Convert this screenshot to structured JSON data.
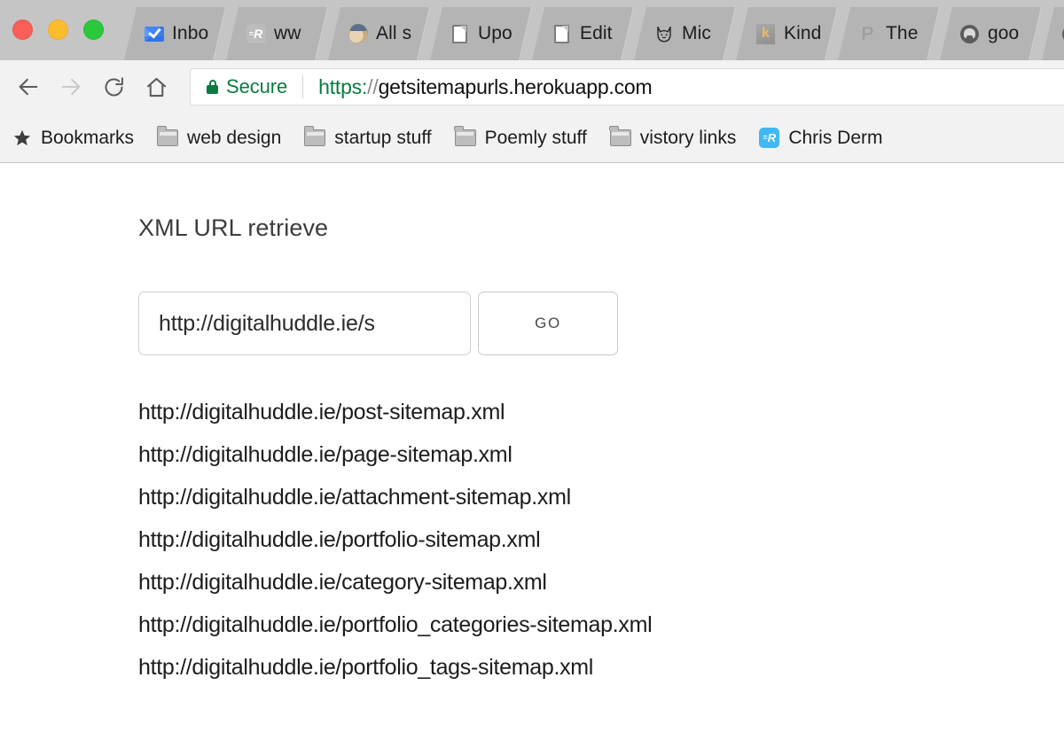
{
  "browser": {
    "window_controls": [
      {
        "name": "close",
        "color": "#f95e57"
      },
      {
        "name": "minimize",
        "color": "#fbbd2e"
      },
      {
        "name": "maximize",
        "color": "#2cc83c"
      }
    ],
    "tabs": [
      {
        "title": "Inbo",
        "favicon": "inbox-icon"
      },
      {
        "title": "ww",
        "favicon": "readme-r-icon"
      },
      {
        "title": "All s",
        "favicon": "mailchimp-icon"
      },
      {
        "title": "Upo",
        "favicon": "document-icon"
      },
      {
        "title": "Edit",
        "favicon": "document-icon"
      },
      {
        "title": "Mic",
        "favicon": "fox-icon"
      },
      {
        "title": "Kind",
        "favicon": "kindle-k-icon"
      },
      {
        "title": "The",
        "favicon": "product-hunt-p-icon"
      },
      {
        "title": "goo",
        "favicon": "github-icon"
      },
      {
        "title": "",
        "favicon": "github-icon"
      }
    ],
    "toolbar": {
      "back_label": "Back",
      "forward_label": "Forward",
      "reload_label": "Reload",
      "home_label": "Home",
      "security_badge": "Secure",
      "security_color": "#0a7b40",
      "url_scheme": "https:",
      "url_slashes": "//",
      "url_host": "getsitemapurls.herokuapp.com",
      "url_full": "https://getsitemapurls.herokuapp.com"
    },
    "bookmarks": [
      {
        "label": "Bookmarks",
        "icon": "star-icon"
      },
      {
        "label": "web design",
        "icon": "folder-icon"
      },
      {
        "label": "startup stuff",
        "icon": "folder-icon"
      },
      {
        "label": "Poemly stuff",
        "icon": "folder-icon"
      },
      {
        "label": "vistory links",
        "icon": "folder-icon"
      },
      {
        "label": "Chris Derm",
        "icon": "readme-r-icon"
      }
    ]
  },
  "page": {
    "title": "XML URL retrieve",
    "form": {
      "input_value": "http://digitalhuddle.ie/s",
      "input_placeholder": "http://digitalhuddle.ie/s",
      "submit_label": "Go"
    },
    "results": [
      "http://digitalhuddle.ie/post-sitemap.xml",
      "http://digitalhuddle.ie/page-sitemap.xml",
      "http://digitalhuddle.ie/attachment-sitemap.xml",
      "http://digitalhuddle.ie/portfolio-sitemap.xml",
      "http://digitalhuddle.ie/category-sitemap.xml",
      "http://digitalhuddle.ie/portfolio_categories-sitemap.xml",
      "http://digitalhuddle.ie/portfolio_tags-sitemap.xml"
    ]
  }
}
